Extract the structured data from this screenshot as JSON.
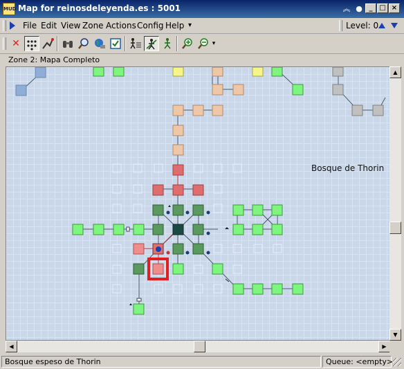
{
  "window": {
    "title": "Map for reinosdeleyenda.es : 5001",
    "app_icon_text": "MUD"
  },
  "menu": {
    "items": [
      "File",
      "Edit",
      "View",
      "Zone",
      "Actions",
      "Config",
      "Help"
    ],
    "overflow": "▾",
    "level_label": "Level: 0"
  },
  "toolbar": {
    "tools": [
      "delete-icon",
      "grid-icon",
      "pathfind-icon",
      "binoculars-icon",
      "find-icon",
      "globe-icon",
      "checkbox-icon",
      "walk-list-icon",
      "walk-icon",
      "walker-icon",
      "zoom-in-icon",
      "zoom-out-icon"
    ]
  },
  "zone": {
    "label": "Zone 2: Mapa Completo"
  },
  "map": {
    "area_label": "Bosque de Thorin",
    "colors": {
      "green": "#7ef57e",
      "dark_green": "#5a9a5f",
      "tan": "#eec7a6",
      "red": "#df6d6d",
      "pink": "#f08c8c",
      "yellow": "#f5f58a",
      "gray": "#c0c0c0",
      "blue": "#8faed6",
      "current_marker": "#e23030",
      "center_room": "#1b4a44"
    }
  },
  "status": {
    "room_name": "Bosque espeso de Thorin",
    "queue": "Queue: <empty>"
  }
}
